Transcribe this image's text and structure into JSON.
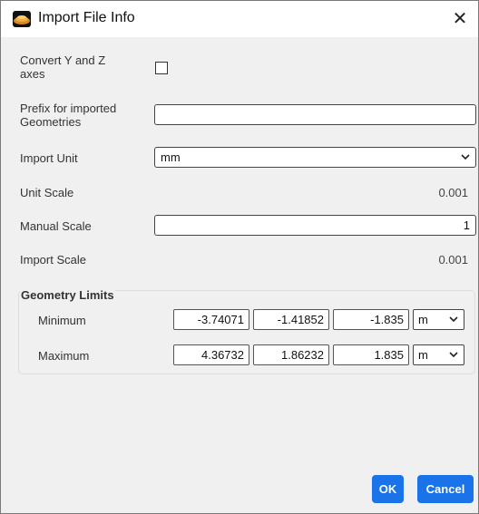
{
  "window": {
    "title": "Import File Info",
    "close_glyph": "✕"
  },
  "fields": {
    "convert_yz": {
      "label_line1": "Convert Y and Z",
      "label_line2": "axes",
      "checked": false
    },
    "prefix": {
      "label_line1": "Prefix for imported",
      "label_line2": "Geometries",
      "value": ""
    },
    "import_unit": {
      "label": "Import Unit",
      "value": "mm"
    },
    "unit_scale": {
      "label": "Unit Scale",
      "value": "0.001"
    },
    "manual_scale": {
      "label": "Manual Scale",
      "value": "1"
    },
    "import_scale": {
      "label": "Import Scale",
      "value": "0.001"
    }
  },
  "geometry_limits": {
    "title": "Geometry Limits",
    "minimum": {
      "label": "Minimum",
      "x": "-3.74071",
      "y": "-1.41852",
      "z": "-1.835",
      "unit": "m"
    },
    "maximum": {
      "label": "Maximum",
      "x": "4.36732",
      "y": "1.86232",
      "z": "1.835",
      "unit": "m"
    }
  },
  "buttons": {
    "ok": "OK",
    "cancel": "Cancel"
  },
  "colors": {
    "accent": "#1a73e8"
  },
  "icons": {
    "app": "app-logo-icon",
    "close": "close-icon",
    "dropdown": "chevron-down-icon"
  }
}
